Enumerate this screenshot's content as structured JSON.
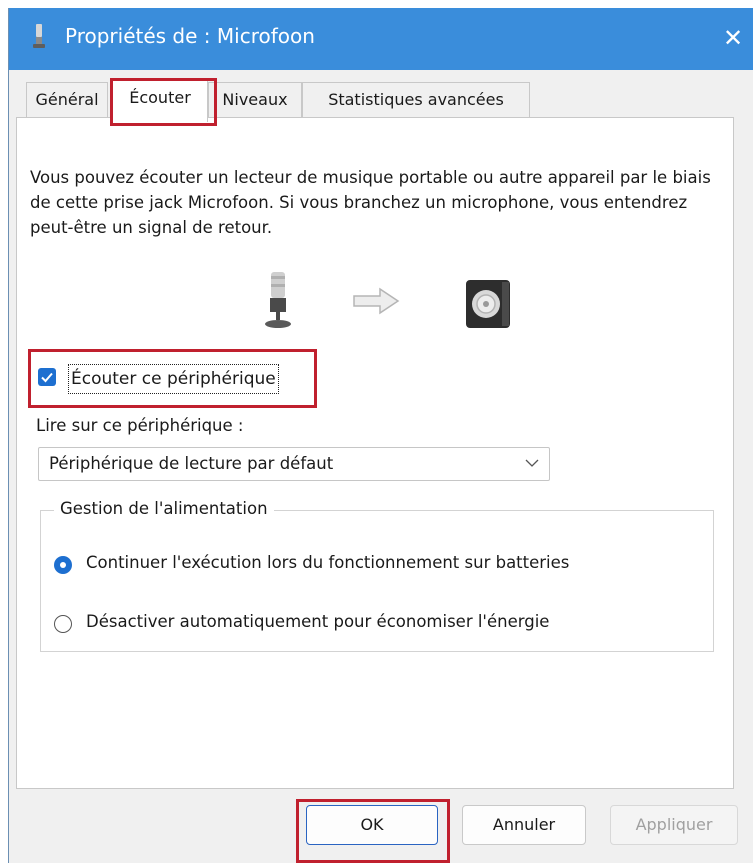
{
  "window": {
    "title": "Propriétés de : Microfoon",
    "close_glyph": "✕"
  },
  "tabs": [
    {
      "label": "Général",
      "active": false
    },
    {
      "label": "Écouter",
      "active": true
    },
    {
      "label": "Niveaux",
      "active": false
    },
    {
      "label": "Statistiques avancées",
      "active": false
    }
  ],
  "listen": {
    "description": "Vous pouvez écouter un lecteur de musique portable ou autre appareil par le biais de cette prise jack Microfoon. Si vous branchez un microphone, vous entendrez peut-être un signal de retour.",
    "icons": [
      "microphone-icon",
      "arrow-right-icon",
      "speaker-icon"
    ],
    "checkbox_label": "Écouter ce périphérique",
    "checkbox_checked": true,
    "playback_label": "Lire sur ce périphérique :",
    "playback_value": "Périphérique de lecture par défaut"
  },
  "power": {
    "legend": "Gestion de l'alimentation",
    "option_continue": "Continuer l'exécution lors du fonctionnement sur batteries",
    "option_disable": "Désactiver automatiquement pour économiser l'énergie",
    "selected": "continue"
  },
  "buttons": {
    "ok": "OK",
    "cancel": "Annuler",
    "apply": "Appliquer"
  },
  "colors": {
    "titlebar": "#3a8ddb",
    "accent": "#1d6fd0",
    "highlight": "#c0202e"
  }
}
